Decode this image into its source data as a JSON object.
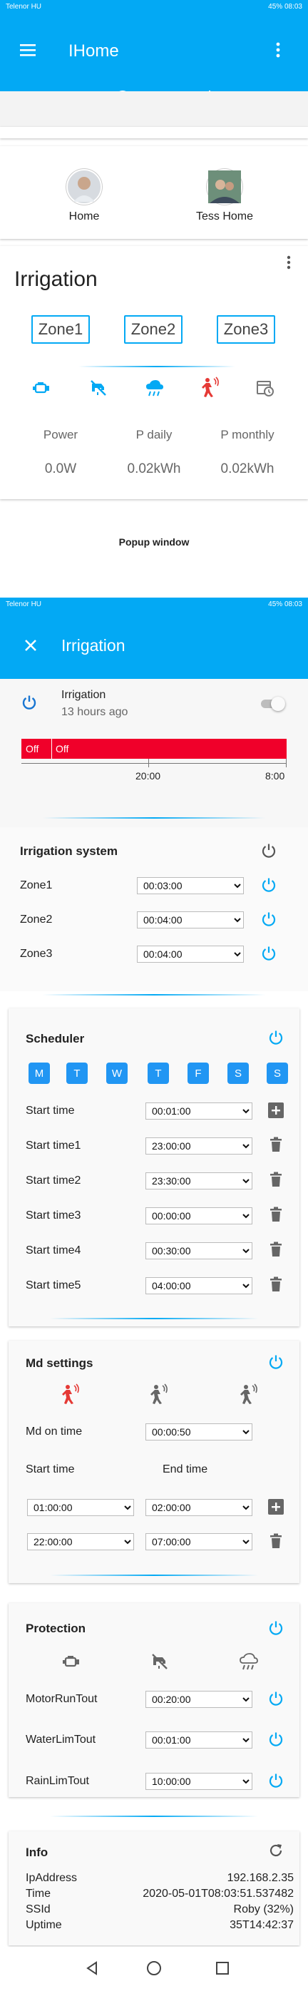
{
  "status_top": {
    "carrier": "Telenor HU",
    "right": "45%  08:03"
  },
  "app": {
    "title": "IHome",
    "menu_icon": "menu-icon",
    "more_icon": "more-vert-icon"
  },
  "tabs": [
    {
      "icon": "home-icon"
    },
    {
      "icon": "play-icon"
    },
    {
      "icon": "camera-icon"
    },
    {
      "icon": "brightness-icon"
    },
    {
      "icon": "monitor-icon"
    },
    {
      "icon": "chevron-right-icon"
    }
  ],
  "users": [
    {
      "name": "Home"
    },
    {
      "name": "Tess Home"
    }
  ],
  "irrigation_card": {
    "title": "Irrigation",
    "zones": [
      "Zone1",
      "Zone2",
      "Zone3"
    ],
    "stats": [
      {
        "label": "Power",
        "value": "0.0W"
      },
      {
        "label": "P daily",
        "value": "0.02kWh"
      },
      {
        "label": "P monthly",
        "value": "0.02kWh"
      }
    ]
  },
  "popup_label": "Popup window",
  "status_popup": {
    "carrier": "Telenor HU",
    "right": "45%  08:03"
  },
  "popup": {
    "title": "Irrigation",
    "entity": {
      "name": "Irrigation",
      "time": "13 hours ago"
    },
    "timeline": {
      "seg1": "Off",
      "seg2": "Off",
      "tick1": "20:00",
      "tick2": "8:00",
      "color": "#f0002a"
    },
    "system": {
      "title": "Irrigation system",
      "rows": [
        {
          "label": "Zone1",
          "value": "00:03:00"
        },
        {
          "label": "Zone2",
          "value": "00:04:00"
        },
        {
          "label": "Zone3",
          "value": "00:04:00"
        }
      ]
    },
    "scheduler": {
      "title": "Scheduler",
      "days": [
        "M",
        "T",
        "W",
        "T",
        "F",
        "S",
        "S"
      ],
      "rows": [
        {
          "label": "Start time",
          "value": "00:01:00",
          "action": "add"
        },
        {
          "label": "Start time1",
          "value": "23:00:00",
          "action": "delete"
        },
        {
          "label": "Start time2",
          "value": "23:30:00",
          "action": "delete"
        },
        {
          "label": "Start time3",
          "value": "00:00:00",
          "action": "delete"
        },
        {
          "label": "Start time4",
          "value": "00:30:00",
          "action": "delete"
        },
        {
          "label": "Start time5",
          "value": "04:00:00",
          "action": "delete"
        }
      ]
    },
    "md": {
      "title": "Md settings",
      "on_time_label": "Md on time",
      "on_time_value": "00:00:50",
      "start_label": "Start time",
      "end_label": "End time",
      "pairs": [
        {
          "start": "01:00:00",
          "end": "02:00:00",
          "action": "add"
        },
        {
          "start": "22:00:00",
          "end": "07:00:00",
          "action": "delete"
        }
      ]
    },
    "protection": {
      "title": "Protection",
      "rows": [
        {
          "label": "MotorRunTout",
          "value": "00:20:00"
        },
        {
          "label": "WaterLimTout",
          "value": "00:01:00"
        },
        {
          "label": "RainLimTout",
          "value": "10:00:00"
        }
      ]
    },
    "info": {
      "title": "Info",
      "rows": [
        {
          "label": "IpAddress",
          "value": "192.168.2.35"
        },
        {
          "label": "Time",
          "value": "2020-05-01T08:03:51.537482"
        },
        {
          "label": "SSId",
          "value": "Roby (32%)"
        },
        {
          "label": "Uptime",
          "value": "35T14:42:37"
        }
      ]
    }
  },
  "colors": {
    "primary": "#03a9f4",
    "alert_red": "#e53935",
    "day_blue": "#2196f3"
  }
}
